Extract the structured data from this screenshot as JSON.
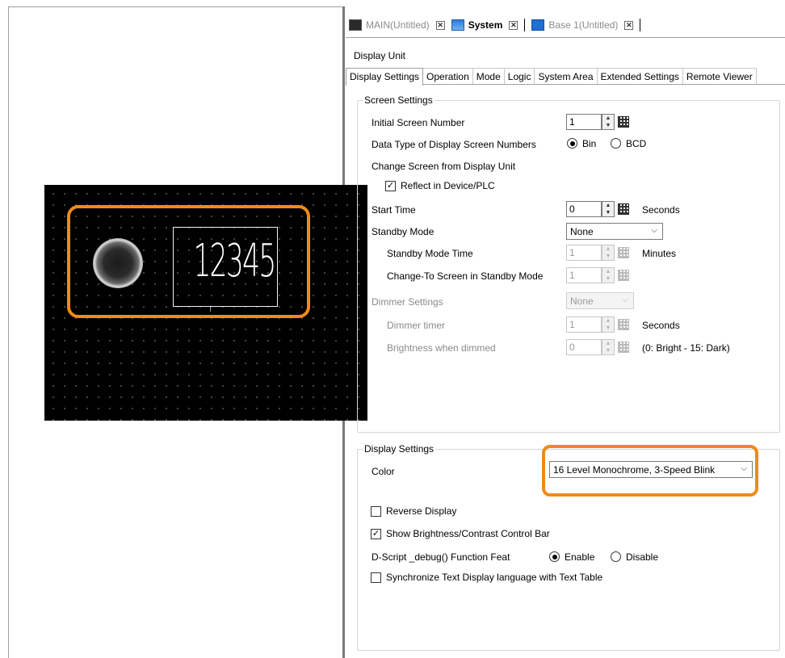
{
  "tabs": [
    {
      "label": "MAIN(Untitled)",
      "icon": "screen-icon",
      "active": false
    },
    {
      "label": "System",
      "icon": "system-icon",
      "active": true
    },
    {
      "label": "Base 1(Untitled)",
      "icon": "base-screen-icon",
      "active": false
    }
  ],
  "close_glyph": "✕",
  "panel_title": "Display Unit",
  "subtabs": [
    "Display Settings",
    "Operation",
    "Mode",
    "Logic",
    "System Area",
    "Extended Settings",
    "Remote Viewer"
  ],
  "preview": {
    "number": "12345"
  },
  "screen_settings": {
    "legend": "Screen Settings",
    "initial_screen_number": {
      "label": "Initial Screen Number",
      "value": "1"
    },
    "data_type": {
      "label": "Data Type of Display Screen Numbers",
      "options": [
        "Bin",
        "BCD"
      ],
      "selected": "Bin"
    },
    "change_screen": {
      "label": "Change Screen from Display Unit"
    },
    "reflect": {
      "label": "Reflect in Device/PLC",
      "checked": true
    },
    "start_time": {
      "label": "Start Time",
      "value": "0",
      "unit": "Seconds"
    },
    "standby_mode": {
      "label": "Standby Mode",
      "value": "None"
    },
    "standby_time": {
      "label": "Standby Mode Time",
      "value": "1",
      "unit": "Minutes"
    },
    "change_to_screen": {
      "label": "Change-To Screen in Standby Mode",
      "value": "1"
    },
    "dimmer_settings": {
      "label": "Dimmer Settings",
      "value": "None"
    },
    "dimmer_timer": {
      "label": "Dimmer timer",
      "value": "1",
      "unit": "Seconds"
    },
    "brightness_dimmed": {
      "label": "Brightness when dimmed",
      "value": "0",
      "unit": "(0: Bright - 15: Dark)"
    }
  },
  "display_settings": {
    "legend": "Display Settings",
    "color": {
      "label": "Color",
      "value": "16 Level Monochrome, 3-Speed Blink"
    },
    "reverse_display": {
      "label": "Reverse Display",
      "checked": false
    },
    "show_brightness": {
      "label": "Show Brightness/Contrast Control Bar",
      "checked": true
    },
    "dscript": {
      "label": "D-Script _debug() Function Feat",
      "options": [
        "Enable",
        "Disable"
      ],
      "selected": "Enable"
    },
    "sync_text": {
      "label": "Synchronize Text Display language with Text Table",
      "checked": false
    }
  },
  "check_glyph": "✓",
  "chevron_glyph": "⌵",
  "spin_up": "▲",
  "spin_down": "▼",
  "accent_color": "#ef8a1a"
}
